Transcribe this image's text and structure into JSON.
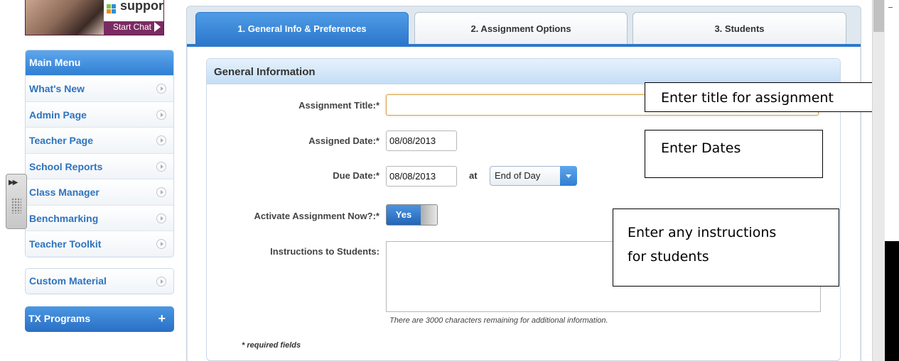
{
  "support": {
    "logo_text": "support",
    "chat_label": "Start Chat"
  },
  "sidebar": {
    "menu_title": "Main Menu",
    "items": [
      {
        "label": "What's New"
      },
      {
        "label": "Admin Page"
      },
      {
        "label": "Teacher Page"
      },
      {
        "label": "School Reports"
      },
      {
        "label": "Class Manager"
      },
      {
        "label": "Benchmarking"
      },
      {
        "label": "Teacher Toolkit"
      }
    ],
    "custom_material": "Custom Material",
    "tx_programs": "TX Programs"
  },
  "tabs": [
    {
      "label": "1. General Info & Preferences",
      "active": true
    },
    {
      "label": "2. Assignment Options",
      "active": false
    },
    {
      "label": "3. Students",
      "active": false
    }
  ],
  "form": {
    "section_title": "General Information",
    "title_label": "Assignment Title:*",
    "title_value": "",
    "assigned_label": "Assigned Date:*",
    "assigned_value": "08/08/2013",
    "due_label": "Due Date:*",
    "due_value": "08/08/2013",
    "at_label": "at",
    "time_value": "End of Day",
    "activate_label": "Activate Assignment Now?:*",
    "activate_value": "Yes",
    "instructions_label": "Instructions to Students:",
    "chars_remaining": "There are 3000 characters remaining for additional information.",
    "required_note": "* required fields"
  },
  "callouts": {
    "title": "Enter title for assignment",
    "dates": "Enter Dates",
    "instructions_line1": "Enter any instructions",
    "instructions_line2": "for students"
  },
  "colors": {
    "accent": "#2d78cc",
    "link": "#2e73bf",
    "support_brand": "#7b2b63"
  }
}
